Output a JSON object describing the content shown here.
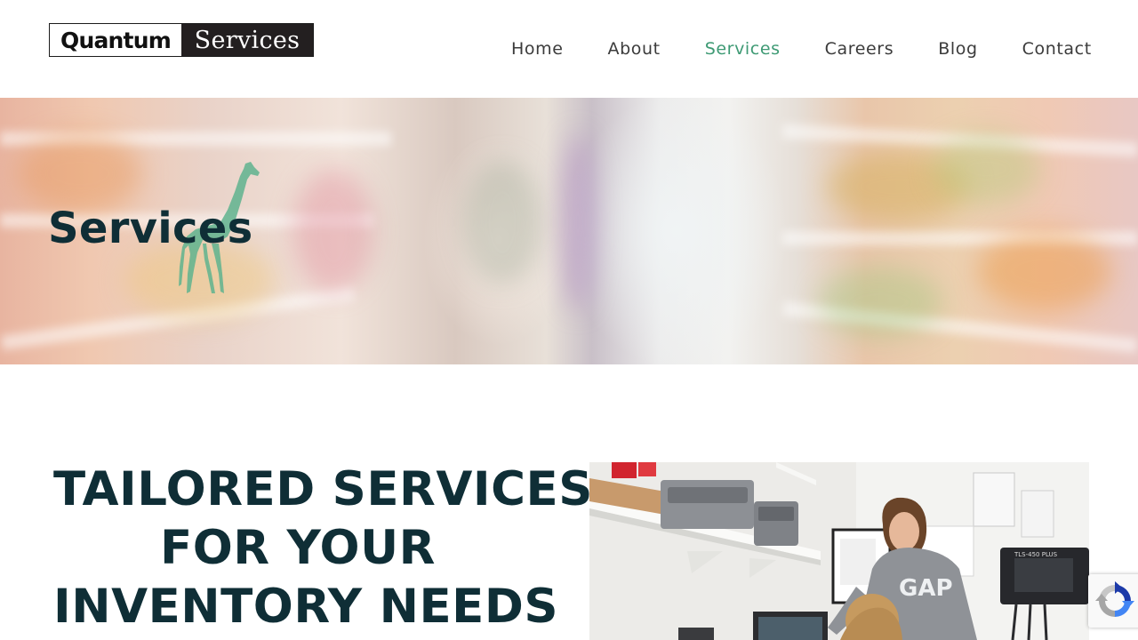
{
  "logo": {
    "left": "Quantum",
    "right": "Services"
  },
  "nav": [
    {
      "label": "Home",
      "active": false
    },
    {
      "label": "About",
      "active": false
    },
    {
      "label": "Services",
      "active": true
    },
    {
      "label": "Careers",
      "active": false
    },
    {
      "label": "Blog",
      "active": false
    },
    {
      "label": "Contact",
      "active": false
    }
  ],
  "hero": {
    "title": "Services"
  },
  "content": {
    "headline_lines": [
      "TAILORED SERVICES",
      "FOR YOUR",
      "INVENTORY NEEDS"
    ],
    "photo_shirt_text": "GAP",
    "photo_label_text": "TLS-450 PLUS"
  },
  "colors": {
    "accent": "#3e9a74",
    "heading": "#0f2e36",
    "logo_dark": "#231f20",
    "giraffe": "#5fb38e"
  },
  "icons": {
    "recaptcha": "recaptcha-icon",
    "giraffe": "giraffe-icon"
  }
}
